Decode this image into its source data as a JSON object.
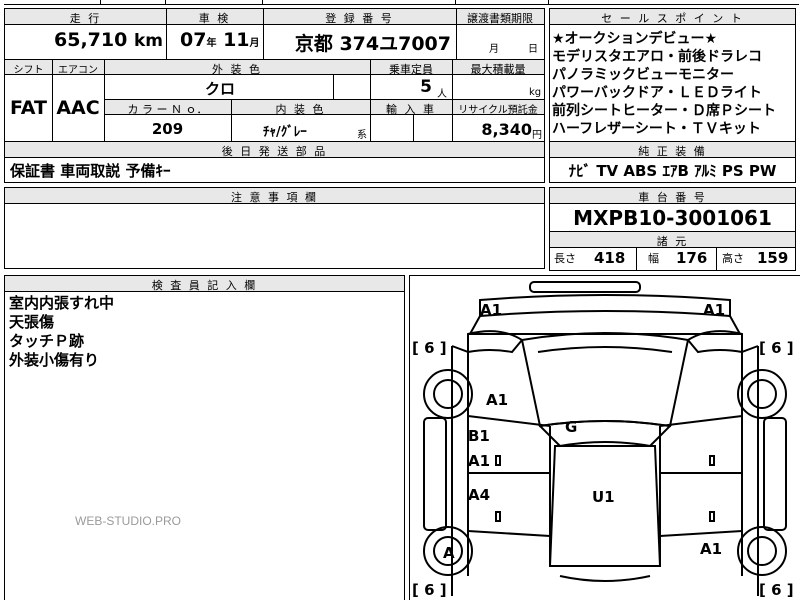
{
  "top_partial": {
    "cells": [
      "",
      "",
      "",
      ""
    ]
  },
  "row1": {
    "mileage_label": "走 行",
    "inspection_label": "車 検",
    "plate_label": "登 録 番 号",
    "transfer_label": "譲渡書類期限",
    "mileage_value": "65,710",
    "mileage_unit": "km",
    "inspection_year": "07",
    "inspection_year_unit": "年",
    "inspection_month": "11",
    "inspection_month_unit": "月",
    "plate_value": "京都 374ユ7007",
    "transfer_month_unit": "月",
    "transfer_day_unit": "日"
  },
  "row2": {
    "shift_label": "シフト",
    "ac_label": "エアコン",
    "exterior_color_label": "外 装 色",
    "capacity_label": "乗車定員",
    "max_load_label": "最大積載量",
    "shift_value": "FAT",
    "ac_value": "AAC",
    "exterior_color_value": "クロ",
    "capacity_value": "5",
    "capacity_unit": "人",
    "load_unit": "kg",
    "color_no_label": "カ ラ ー Ｎ ｏ．",
    "interior_color_label": "内 装 色",
    "import_label": "輸 入 車",
    "recycle_label": "リサイクル預託金",
    "color_no_value": "209",
    "interior_color_value": "ﾁｬ/ｸﾞﾚｰ",
    "interior_suffix": "系",
    "recycle_value": "8,340",
    "recycle_unit": "円"
  },
  "accessories": {
    "label": "後 日 発 送 部 品",
    "value": "保証書 車両取説 予備ｷｰ"
  },
  "notes": {
    "label": "注 意 事 項 欄",
    "value": ""
  },
  "inspector": {
    "label": "検 査 員 記 入 欄",
    "lines": [
      "室内内張すれ中",
      "天張傷",
      "タッチＰ跡",
      "外装小傷有り"
    ]
  },
  "sales_points": {
    "label": "セ ー ル ス ポ イ ン ト",
    "lines": [
      "★オークションデビュー★",
      "モデリスタエアロ・前後ドラレコ",
      "パノラミックビューモニター",
      "パワーバックドア・ＬＥＤライト",
      "前列シートヒーター・Ｄ席Ｐシート",
      "ハーフレザーシート・ＴＶキット"
    ]
  },
  "equipment": {
    "label": "純 正 装 備",
    "value": "ﾅﾋﾞ TV ABS ｴｱB ｱﾙﾐ PS PW"
  },
  "chassis": {
    "label": "車 台 番 号",
    "value": "MXPB10-3001061"
  },
  "specs": {
    "label": "諸 元",
    "length_label": "長さ",
    "length_value": "418",
    "width_label": "幅",
    "width_value": "176",
    "height_label": "高さ",
    "height_value": "159"
  },
  "diagram": {
    "front_left": "A1",
    "front_right": "A1",
    "tire_fl": "[ 6 ]",
    "tire_fr": "[ 6 ]",
    "tire_rl": "[ 6 ]",
    "tire_rr": "[ 6 ]",
    "fender_left": "A1",
    "front_door_left_1": "B1",
    "front_door_left_2": "A1",
    "rear_door_left": "A4",
    "rear_wheel_left": "A",
    "roof_front": "G",
    "roof": "U1",
    "rear_right": "A1"
  },
  "watermark": "WEB-STUDIO.PRO"
}
